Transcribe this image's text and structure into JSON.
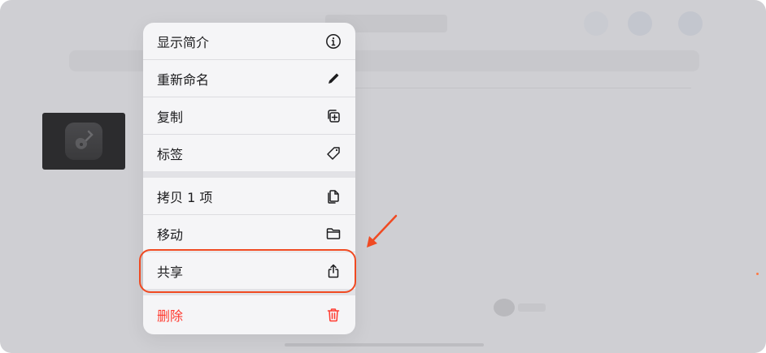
{
  "context_menu": {
    "items": [
      {
        "label": "显示简介",
        "icon": "info-circle-icon"
      },
      {
        "label": "重新命名",
        "icon": "pencil-icon"
      },
      {
        "label": "复制",
        "icon": "duplicate-icon"
      },
      {
        "label": "标签",
        "icon": "tag-icon"
      },
      {
        "label": "拷贝 1 项",
        "icon": "copy-document-icon"
      },
      {
        "label": "移动",
        "icon": "folder-icon"
      },
      {
        "label": "共享",
        "icon": "share-icon"
      },
      {
        "label": "删除",
        "icon": "trash-icon"
      }
    ]
  },
  "colors": {
    "destructive": "#ff3b30",
    "annotation": "#f04a22",
    "menu_background": "#f5f5f7"
  }
}
